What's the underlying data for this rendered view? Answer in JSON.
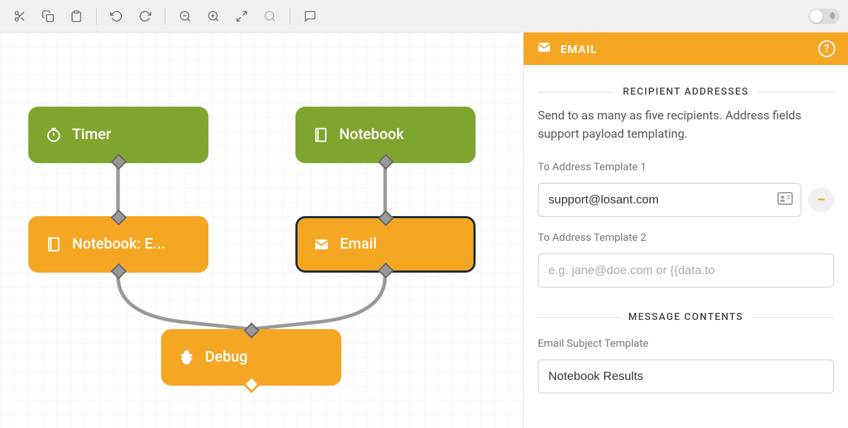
{
  "panel": {
    "title": "EMAIL",
    "sections": {
      "recipients": {
        "heading": "RECIPIENT ADDRESSES",
        "description": "Send to as many as five recipients. Address fields support payload templating.",
        "fields": [
          {
            "label": "To Address Template 1",
            "value": "support@losant.com",
            "placeholder": ""
          },
          {
            "label": "To Address Template 2",
            "value": "",
            "placeholder": "e.g. jane@doe.com or {{data.to"
          }
        ]
      },
      "message": {
        "heading": "MESSAGE CONTENTS",
        "subject_label": "Email Subject Template",
        "subject_value": "Notebook Results"
      }
    }
  },
  "nodes": {
    "timer": {
      "label": "Timer"
    },
    "notebook": {
      "label": "Notebook"
    },
    "notebook_exec": {
      "label": "Notebook: E..."
    },
    "email": {
      "label": "Email"
    },
    "debug": {
      "label": "Debug"
    }
  }
}
